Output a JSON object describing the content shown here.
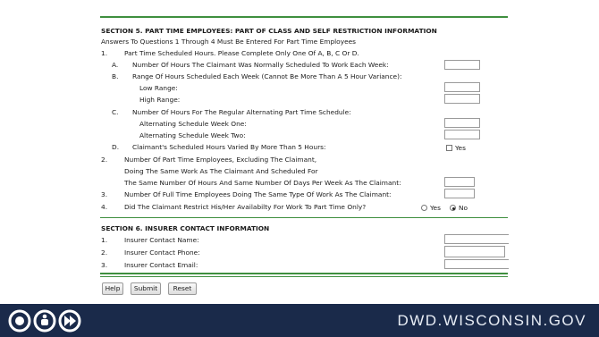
{
  "section5": {
    "heading": "SECTION 5.  PART TIME EMPLOYEES: PART OF CLASS AND SELF RESTRICTION INFORMATION",
    "note": "Answers To Questions 1 Through 4 Must Be Entered For Part Time Employees",
    "q1": {
      "num": "1.",
      "text": "Part Time Scheduled Hours. Please Complete Only One Of A, B, C Or D."
    },
    "a": {
      "letter": "A.",
      "text": "Number Of Hours The Claimant Was Normally Scheduled To Work Each Week:"
    },
    "b": {
      "letter": "B.",
      "text": "Range Of Hours Scheduled Each Week (Cannot Be More Than A 5 Hour Variance):",
      "low": "Low Range:",
      "high": "High Range:"
    },
    "c": {
      "letter": "C.",
      "text": "Number Of Hours For The Regular Alternating Part Time Schedule:",
      "week1": "Alternating Schedule Week One:",
      "week2": "Alternating Schedule Week Two:"
    },
    "d": {
      "letter": "D.",
      "text": "Claimant's Scheduled Hours Varied By More Than 5 Hours:",
      "yes": "Yes"
    },
    "q2": {
      "num": "2.",
      "line1": "Number Of Part Time Employees, Excluding The Claimant,",
      "line2": "Doing The Same Work As The Claimant And Scheduled For",
      "line3": "The Same Number Of Hours And Same Number Of Days Per Week As The Claimant:"
    },
    "q3": {
      "num": "3.",
      "text": "Number Of Full Time Employees Doing The Same Type Of Work As The Claimant:"
    },
    "q4": {
      "num": "4.",
      "text": "Did The Claimant Restrict His/Her Availabilty For Work To Part Time Only?",
      "yes": "Yes",
      "no": "No",
      "selected": "No"
    }
  },
  "section6": {
    "heading": "SECTION 6.  INSURER CONTACT INFORMATION",
    "r1": {
      "num": "1.",
      "text": "Insurer Contact Name:"
    },
    "r2": {
      "num": "2.",
      "text": "Insurer Contact Phone:"
    },
    "r3": {
      "num": "3.",
      "text": "Insurer Contact Email:"
    }
  },
  "buttons": {
    "help": "Help",
    "submit": "Submit",
    "reset": "Reset"
  },
  "footer": {
    "domain": "DWD.WISCONSIN.GOV",
    "logo_icon": "accessibility-logo-icons"
  },
  "colors": {
    "rule": "#3f8f3f",
    "footer_bg": "#1a2a4a",
    "footer_text": "#e8edf5"
  }
}
